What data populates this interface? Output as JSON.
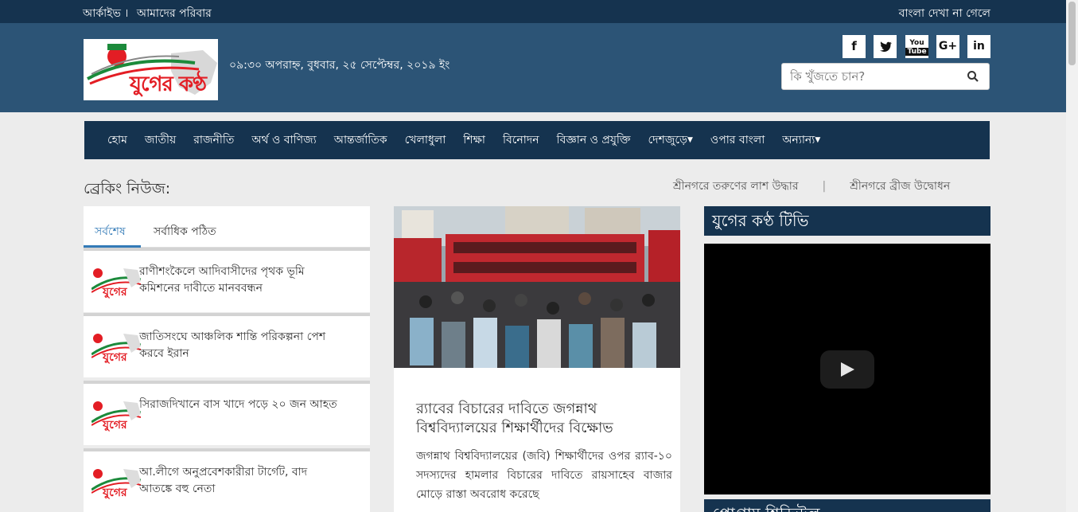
{
  "topbar": {
    "archive": "আর্কাইভ ।",
    "family": "আমাদের পরিবার",
    "font_help": "বাংলা দেখা না গেলে"
  },
  "header": {
    "logo_text": "যুগের কণ্ঠ",
    "datetime": "০৯:৩০ অপরাহ্ন, বুধবার, ২৫ সেপ্টেম্বর, ২০১৯ ইং",
    "social": [
      {
        "icon": "facebook-icon",
        "glyph": "f"
      },
      {
        "icon": "twitter-icon",
        "glyph": "t"
      },
      {
        "icon": "youtube-icon",
        "glyph": "You"
      },
      {
        "icon": "google-plus-icon",
        "glyph": "G+"
      },
      {
        "icon": "linkedin-icon",
        "glyph": "in"
      }
    ],
    "search_placeholder": "কি খুঁজতে চান?"
  },
  "nav": {
    "items": [
      "হোম",
      "জাতীয়",
      "রাজনীতি",
      "অর্থ ও বাণিজ্য",
      "আন্তর্জাতিক",
      "খেলাধুলা",
      "শিক্ষা",
      "বিনোদন",
      "বিজ্ঞান ও প্রযুক্তি",
      "দেশজুড়ে",
      "ওপার বাংলা",
      "অন্যান্য"
    ]
  },
  "breaking": {
    "label": "ব্রেকিং নিউজ:",
    "items": [
      "শ্রীনগরে তরুণের লাশ উদ্ধার",
      "শ্রীনগরে ব্রীজ উদ্বোধন"
    ]
  },
  "tabs": {
    "latest": "সর্বশেষ",
    "most_read": "সর্বাধিক পঠিত"
  },
  "news_list": [
    {
      "title": "রাণীশংকৈলে আদিবাসীদের পৃথক ভূমি কমিশনের দাবীতে মানববন্ধন",
      "thumb_text": "যুগের"
    },
    {
      "title": "জাতিসংঘে আঞ্চলিক শান্তি পরিকল্পনা পেশ করবে ইরান",
      "thumb_text": "যুগের"
    },
    {
      "title": "সিরাজদিখানে বাস খাদে পড়ে ২০ জন আহত",
      "thumb_text": "যুগের"
    },
    {
      "title": "আ.লীগে অনুপ্রবেশকারীরা টার্গেট, বাদ আতঙ্কে বহু নেতা",
      "thumb_text": "যুগের"
    }
  ],
  "lead": {
    "headline": "র‍্যাবের বিচারের দাবিতে জগন্নাথ বিশ্ববিদ্যালয়ের শিক্ষার্থীদের বিক্ষোভ",
    "body": "জগন্নাথ বিশ্ববিদ্যালয়ের (জবি) শিক্ষার্থীদের ওপর র‍্যাব-১০ সদস্যদের হামলার বিচারের দাবিতে রায়সাহেব বাজার মোড়ে রাস্তা অবরোধ করেছে"
  },
  "right": {
    "tv_title": "যুগের কণ্ঠ টিভি",
    "program_title": "প্রোগ্রাম শিডিউল"
  },
  "colors": {
    "topbar": "#15334f",
    "header": "#2c5476",
    "nav": "#15334f",
    "accent": "#337ab7",
    "brand_red": "#e31d24",
    "brand_green": "#1c8a3b"
  }
}
